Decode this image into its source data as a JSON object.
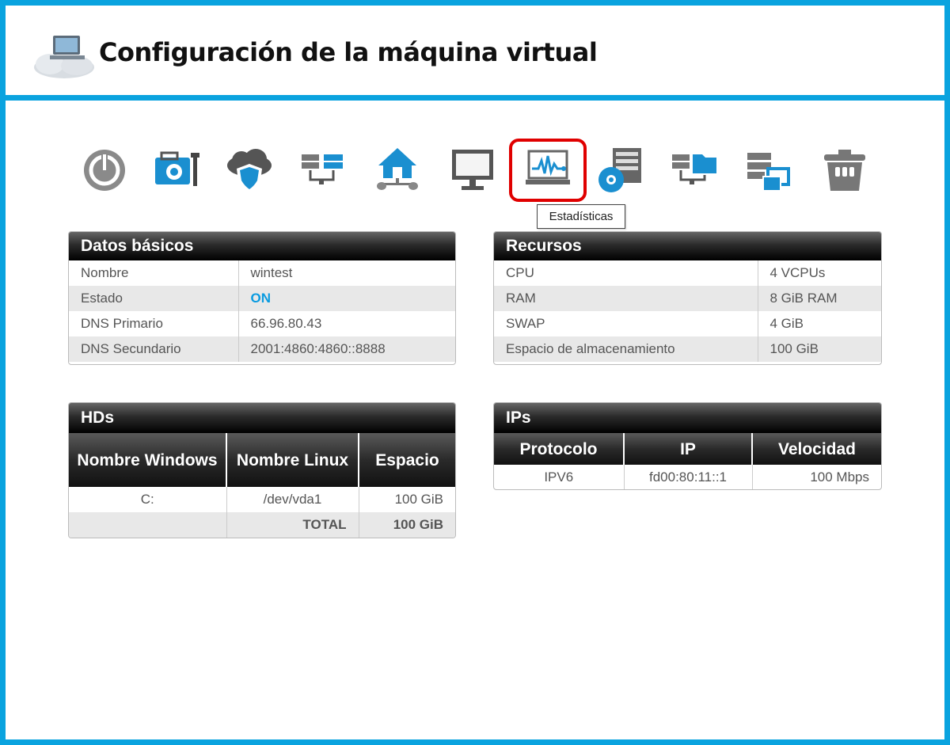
{
  "header": {
    "title": "Configuración de la máquina virtual",
    "logo_icon": "cloud-computer-icon"
  },
  "toolbar": {
    "items": [
      {
        "icon": "power-icon"
      },
      {
        "icon": "toolbox-icon"
      },
      {
        "icon": "cloud-shield-icon"
      },
      {
        "icon": "network-servers-icon"
      },
      {
        "icon": "home-network-icon"
      },
      {
        "icon": "monitor-icon"
      },
      {
        "icon": "statistics-icon",
        "active": true
      },
      {
        "icon": "disc-server-icon"
      },
      {
        "icon": "server-folder-icon"
      },
      {
        "icon": "server-images-icon"
      },
      {
        "icon": "trash-icon"
      }
    ],
    "tooltip": "Estadísticas"
  },
  "basic": {
    "title": "Datos básicos",
    "rows": [
      {
        "label": "Nombre",
        "value": "wintest"
      },
      {
        "label": "Estado",
        "value": "ON"
      },
      {
        "label": "DNS Primario",
        "value": "66.96.80.43"
      },
      {
        "label": "DNS Secundario",
        "value": "2001:4860:4860::8888"
      }
    ]
  },
  "resources": {
    "title": "Recursos",
    "rows": [
      {
        "label": "CPU",
        "value": "4 VCPUs"
      },
      {
        "label": "RAM",
        "value": "8 GiB RAM"
      },
      {
        "label": "SWAP",
        "value": "4 GiB"
      },
      {
        "label": "Espacio de almacenamiento",
        "value": "100 GiB"
      }
    ]
  },
  "hds": {
    "title": "HDs",
    "headers": [
      "Nombre Windows",
      "Nombre Linux",
      "Espacio"
    ],
    "rows": [
      {
        "windows": "C:",
        "linux": "/dev/vda1",
        "space": "100 GiB"
      }
    ],
    "total_label": "TOTAL",
    "total_value": "100 GiB"
  },
  "ips": {
    "title": "IPs",
    "headers": [
      "Protocolo",
      "IP",
      "Velocidad"
    ],
    "rows": [
      {
        "protocol": "IPV6",
        "ip": "fd00:80:11::1",
        "speed": "100 Mbps"
      }
    ]
  },
  "colors": {
    "accent": "#0aa3df",
    "status_on": "#0a9be0",
    "active_outline": "#e00000"
  }
}
